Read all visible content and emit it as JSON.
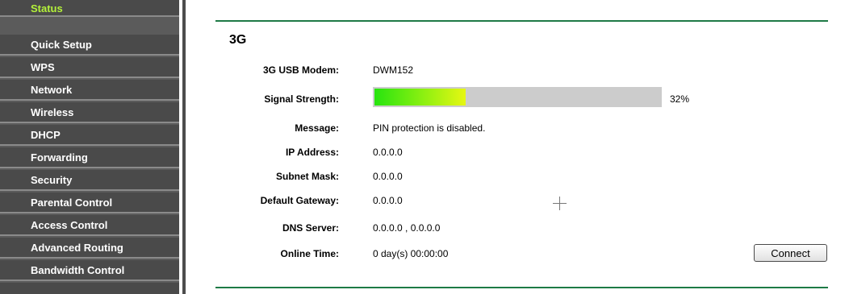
{
  "sidebar": {
    "items": [
      {
        "label": "Status",
        "active": true
      },
      {
        "label": "Quick Setup"
      },
      {
        "label": "WPS"
      },
      {
        "label": "Network"
      },
      {
        "label": "Wireless"
      },
      {
        "label": "DHCP"
      },
      {
        "label": "Forwarding"
      },
      {
        "label": "Security"
      },
      {
        "label": "Parental Control"
      },
      {
        "label": "Access Control"
      },
      {
        "label": "Advanced Routing"
      },
      {
        "label": "Bandwidth Control"
      }
    ]
  },
  "section": {
    "title": "3G",
    "modem_label": "3G USB Modem:",
    "modem_value": "DWM152",
    "signal_label": "Signal Strength:",
    "signal_percent_text": "32%",
    "signal_fraction": 0.32,
    "message_label": "Message:",
    "message_value": "PIN protection is disabled.",
    "ip_label": "IP Address:",
    "ip_value": "0.0.0.0",
    "subnet_label": "Subnet Mask:",
    "subnet_value": "0.0.0.0",
    "gateway_label": "Default Gateway:",
    "gateway_value": "0.0.0.0",
    "dns_label": "DNS Server:",
    "dns_value": "0.0.0.0 , 0.0.0.0",
    "online_label": "Online Time:",
    "online_value": "0 day(s) 00:00:00",
    "connect_label": "Connect"
  },
  "colors": {
    "sidebar_bg": "#4a4a4a",
    "active_item": "#b4f23a",
    "rule": "#1e7a46",
    "signal_track": "#cccccc"
  }
}
